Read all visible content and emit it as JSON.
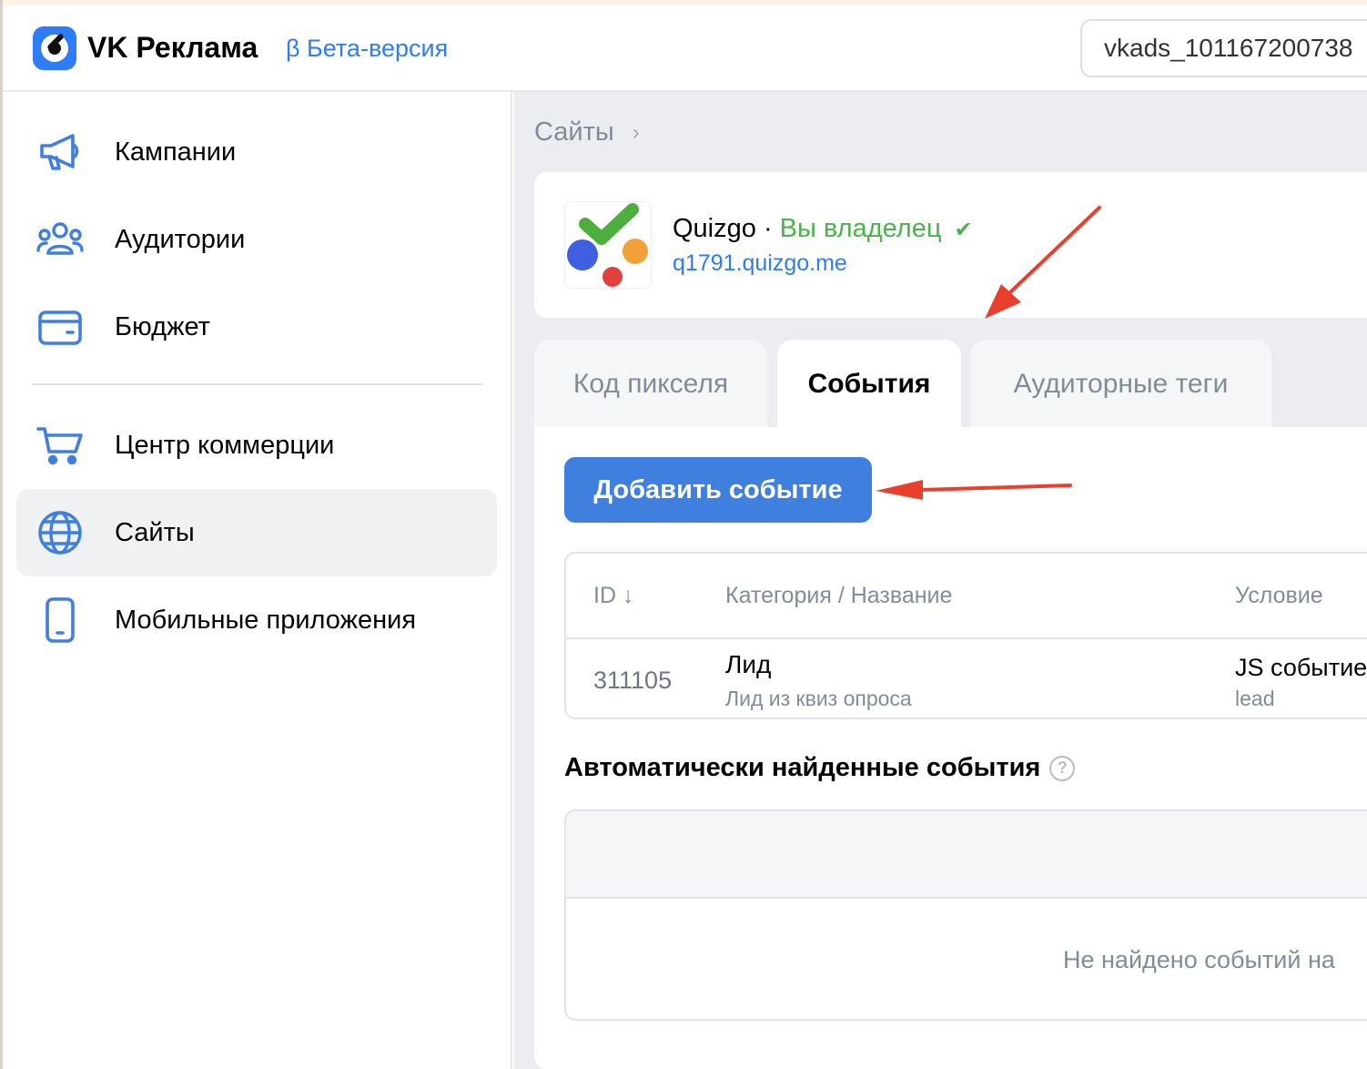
{
  "header": {
    "brand": "VK Реклама",
    "beta_label": "β Бета-версия",
    "account": "vkads_101167200738"
  },
  "sidebar": {
    "items": [
      {
        "label": "Кампании",
        "icon": "megaphone-icon"
      },
      {
        "label": "Аудитории",
        "icon": "users-icon"
      },
      {
        "label": "Бюджет",
        "icon": "wallet-icon"
      },
      {
        "label": "Центр коммерции",
        "icon": "cart-icon"
      },
      {
        "label": "Сайты",
        "icon": "globe-icon",
        "active": true
      },
      {
        "label": "Мобильные приложения",
        "icon": "phone-icon"
      }
    ]
  },
  "breadcrumb": {
    "root": "Сайты",
    "separator": "›"
  },
  "site": {
    "name": "Quizgo",
    "separator": " · ",
    "owner_status": "Вы владелец",
    "owner_mark": "✔",
    "url": "q1791.quizgo.me"
  },
  "tabs": [
    {
      "label": "Код пикселя",
      "active": false
    },
    {
      "label": "События",
      "active": true
    },
    {
      "label": "Аудиторные теги",
      "active": false
    }
  ],
  "events": {
    "add_button": "Добавить событие",
    "columns": {
      "id": "ID ↓",
      "category": "Категория / Название",
      "condition": "Условие"
    },
    "rows": [
      {
        "id": "311105",
        "category": "Лид",
        "name": "Лид из квиз опроса",
        "condition": "JS событие",
        "condition_value": "lead"
      }
    ]
  },
  "auto_events": {
    "title": "Автоматически найденные события",
    "help": "?",
    "empty": "Не найдено событий на"
  },
  "colors": {
    "accent": "#2e7cf6",
    "button": "#3f7fdd",
    "owner_green": "#4bb34b",
    "annotation_arrow": "#e8402d"
  }
}
